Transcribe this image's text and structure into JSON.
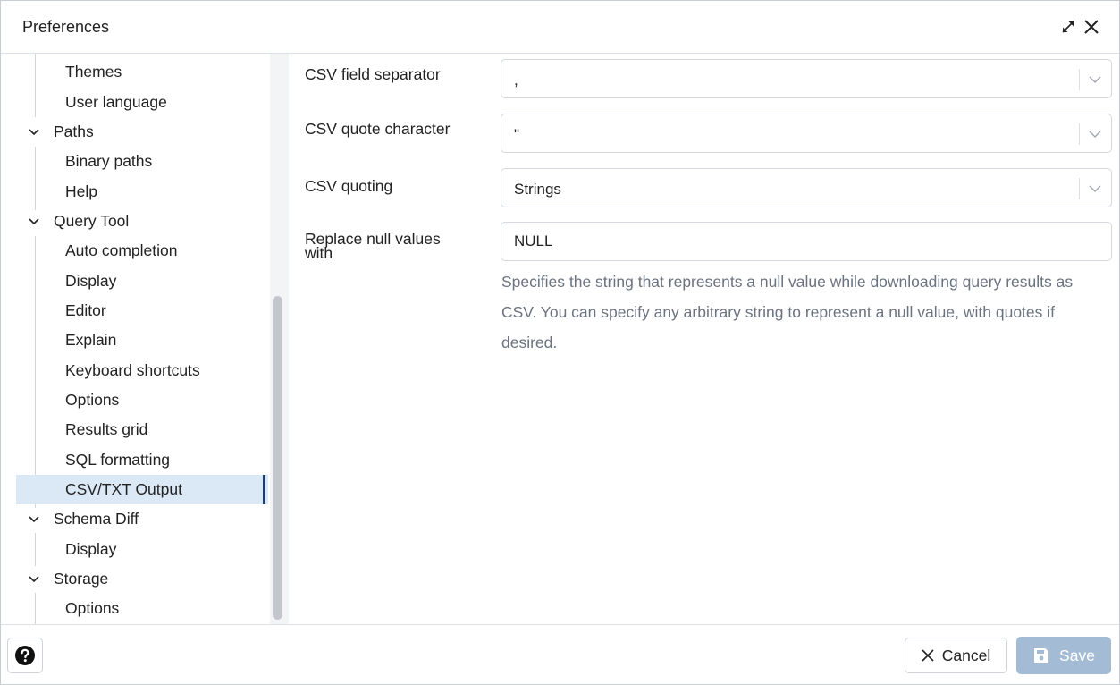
{
  "window": {
    "title": "Preferences",
    "expand_icon": "expand-icon",
    "close_icon": "close-icon"
  },
  "tree": {
    "items": [
      {
        "label": "Themes",
        "level": 2
      },
      {
        "label": "User language",
        "level": 2
      },
      {
        "label": "Paths",
        "level": 1,
        "expanded": true
      },
      {
        "label": "Binary paths",
        "level": 2
      },
      {
        "label": "Help",
        "level": 2
      },
      {
        "label": "Query Tool",
        "level": 1,
        "expanded": true
      },
      {
        "label": "Auto completion",
        "level": 2
      },
      {
        "label": "Display",
        "level": 2
      },
      {
        "label": "Editor",
        "level": 2
      },
      {
        "label": "Explain",
        "level": 2
      },
      {
        "label": "Keyboard shortcuts",
        "level": 2
      },
      {
        "label": "Options",
        "level": 2
      },
      {
        "label": "Results grid",
        "level": 2
      },
      {
        "label": "SQL formatting",
        "level": 2
      },
      {
        "label": "CSV/TXT Output",
        "level": 2,
        "selected": true
      },
      {
        "label": "Schema Diff",
        "level": 1,
        "expanded": true
      },
      {
        "label": "Display",
        "level": 2
      },
      {
        "label": "Storage",
        "level": 1,
        "expanded": true
      },
      {
        "label": "Options",
        "level": 2
      }
    ]
  },
  "form": {
    "csv_field_separator": {
      "label": "CSV field separator",
      "value": ","
    },
    "csv_quote_character": {
      "label": "CSV quote character",
      "value": "\""
    },
    "csv_quoting": {
      "label": "CSV quoting",
      "value": "Strings"
    },
    "replace_null": {
      "label_line1": "Replace null values",
      "label_line2": "with",
      "value": "NULL",
      "help": "Specifies the string that represents a null value while downloading query results as CSV. You can specify any arbitrary string to represent a null value, with quotes if desired."
    }
  },
  "footer": {
    "help_icon": "help-icon",
    "cancel_label": "Cancel",
    "save_label": "Save"
  },
  "colors": {
    "selected_bg": "#dbe9f7",
    "selected_marker": "#1f3d6b",
    "save_bg_disabled": "#a4bbd6",
    "help_text": "#6b7380"
  }
}
